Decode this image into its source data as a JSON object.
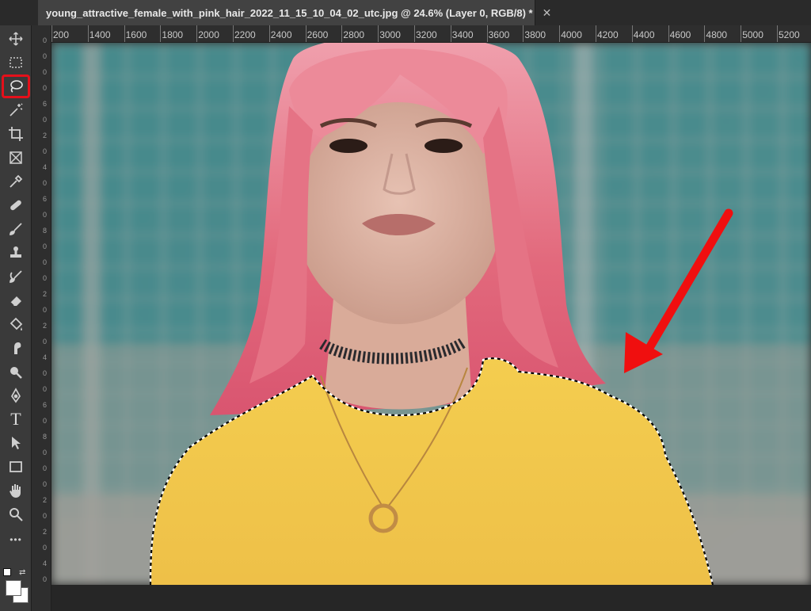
{
  "document": {
    "tab_title": "young_attractive_female_with_pink_hair_2022_11_15_10_04_02_utc.jpg @ 24.6% (Layer 0, RGB/8) *",
    "close_glyph": "✕"
  },
  "ruler": {
    "horizontal_labels": [
      "200",
      "1400",
      "1600",
      "1800",
      "2000",
      "2200",
      "2400",
      "2600",
      "2800",
      "3000",
      "3200",
      "3400",
      "3600",
      "3800",
      "4000",
      "4200",
      "4400",
      "4600",
      "4800",
      "5000",
      "5200"
    ],
    "vertical_digits": [
      "0",
      "0",
      "0",
      "0",
      "6",
      "0",
      "2",
      "0",
      "4",
      "0",
      "6",
      "0",
      "8",
      "0",
      "0",
      "0",
      "2",
      "0",
      "2",
      "0",
      "4",
      "0",
      "0",
      "6",
      "0",
      "8",
      "0",
      "0",
      "0",
      "2",
      "0",
      "2",
      "0",
      "4",
      "0"
    ]
  },
  "toolbar": {
    "active_tool": "lasso",
    "tools": [
      "move",
      "marquee",
      "lasso",
      "magic-wand",
      "crop",
      "frame",
      "eyedropper",
      "healing",
      "brush",
      "stamp",
      "history-brush",
      "eraser",
      "paint-bucket",
      "smudge",
      "dodge",
      "pen",
      "type",
      "path-selection",
      "rectangle",
      "hand",
      "zoom",
      "more"
    ],
    "type_glyph": "T",
    "more_glyph": "•••"
  },
  "colors": {
    "highlight": "#e5101a",
    "hair": "#e2697c",
    "shirt": "#f0c545",
    "background_teal": "#3f8a8c",
    "arrow": "#f00f0f"
  }
}
